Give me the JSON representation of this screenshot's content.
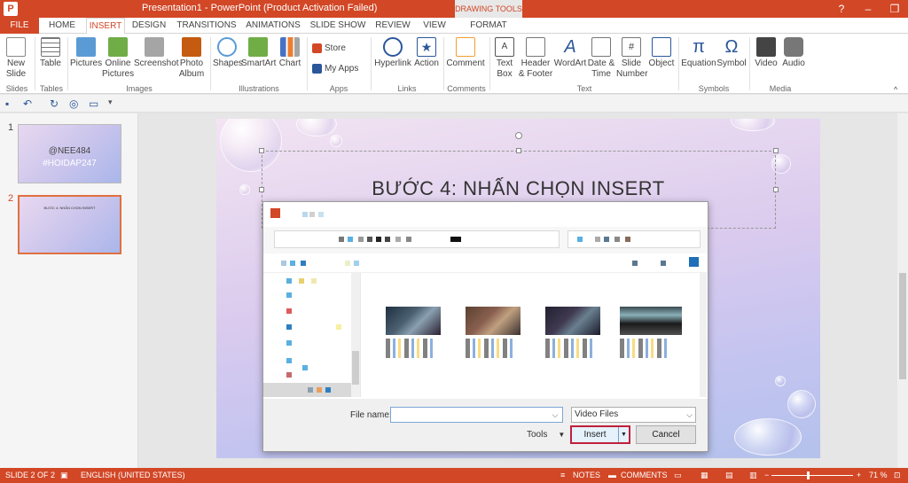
{
  "titlebar": {
    "logo": "P",
    "title": "Presentation1 - PowerPoint (Product Activation Failed)",
    "context_tab": "DRAWING TOOLS",
    "help": "?",
    "minimize": "–",
    "restore": "❐",
    "close": "✕"
  },
  "tabs": [
    {
      "label": "FILE"
    },
    {
      "label": "HOME"
    },
    {
      "label": "INSERT"
    },
    {
      "label": "DESIGN"
    },
    {
      "label": "TRANSITIONS"
    },
    {
      "label": "ANIMATIONS"
    },
    {
      "label": "SLIDE SHOW"
    },
    {
      "label": "REVIEW"
    },
    {
      "label": "VIEW"
    },
    {
      "label": "FORMAT"
    }
  ],
  "ribbon": {
    "new_slide": "New Slide",
    "table": "Table",
    "pictures": "Pictures",
    "online_pictures": "Online Pictures",
    "screenshot": "Screenshot",
    "photo_album": "Photo Album",
    "shapes": "Shapes",
    "smartart": "SmartArt",
    "chart": "Chart",
    "store": "Store",
    "my_apps": "My Apps",
    "hyperlink": "Hyperlink",
    "action": "Action",
    "comment": "Comment",
    "text_box": "Text Box",
    "header_footer": "Header & Footer",
    "wordart": "WordArt",
    "date_time": "Date & Time",
    "slide_number": "Slide Number",
    "object": "Object",
    "equation": "Equation",
    "symbol": "Symbol",
    "video": "Video",
    "audio": "Audio",
    "groups": {
      "slides": "Slides",
      "tables": "Tables",
      "images": "Images",
      "illustrations": "Illustrations",
      "apps": "Apps",
      "links": "Links",
      "comments": "Comments",
      "text": "Text",
      "symbols": "Symbols",
      "media": "Media"
    }
  },
  "thumbnails": [
    {
      "num": "1",
      "line1": "@NEE484",
      "line2": "#HOIDAP247"
    },
    {
      "num": "2",
      "line1": "BƯỚC 4: NHẤN CHỌN INSERT"
    }
  ],
  "slide": {
    "title": "BƯỚC 4: NHẤN CHỌN INSERT"
  },
  "dialog": {
    "file_name_label": "File name:",
    "file_name_value": "",
    "file_type": "Video Files",
    "tools": "Tools",
    "insert": "Insert",
    "cancel": "Cancel"
  },
  "statusbar": {
    "slide": "SLIDE 2 OF 2",
    "language": "ENGLISH (UNITED STATES)",
    "notes": "NOTES",
    "comments": "COMMENTS",
    "zoom_minus": "−",
    "zoom_plus": "+",
    "zoom": "71 %"
  },
  "colors": {
    "accent": "#d24726",
    "insert_highlight": "#c0203c"
  }
}
